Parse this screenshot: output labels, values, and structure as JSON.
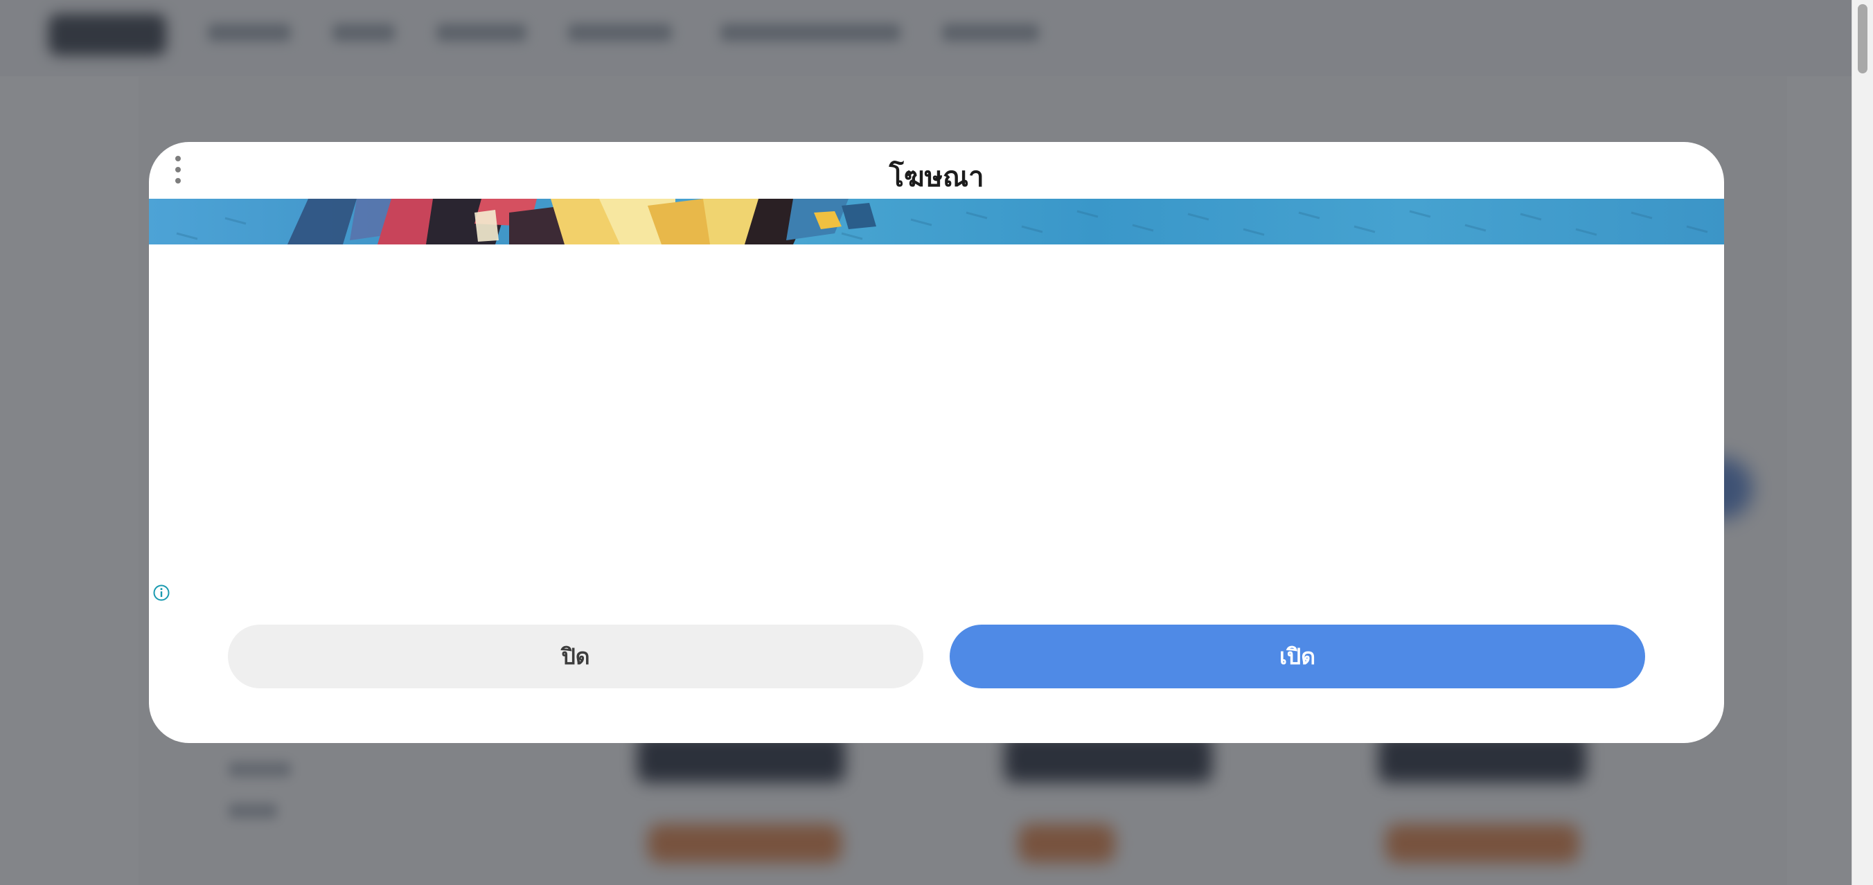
{
  "modal": {
    "title": "โฆษณา",
    "menu_icon": "more-vertical-icon",
    "info_icon": "info-circle-icon",
    "close_button_label": "ปิด",
    "open_button_label": "เปิด"
  },
  "colors": {
    "overlay": "rgba(55,58,64,0.62)",
    "primary_button": "#4f8ae6",
    "secondary_button": "#efefef",
    "info_icon": "#1a9ab0"
  }
}
